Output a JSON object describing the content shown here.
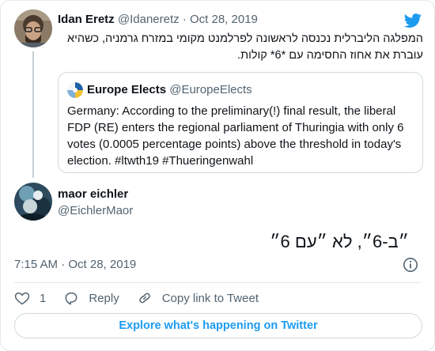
{
  "colors": {
    "accent": "#1d9bf0",
    "text": "#0f1419",
    "muted": "#536471",
    "border": "#cfd9de"
  },
  "parent": {
    "name": "Idan Eretz",
    "handle": "@Idaneretz",
    "separator": "·",
    "date": "Oct 28, 2019",
    "text": "המפלגה הליברלית נכנסה לראשונה לפרלמנט מקומי במזרח גרמניה, כשהיא עוברת את אחוז החסימה עם *6* קולות."
  },
  "quote": {
    "name": "Europe Elects",
    "handle": "@EuropeElects",
    "text": "Germany: According to the preliminary(!) final result, the liberal FDP (RE) enters the regional parliament of Thuringia with only 6 votes (0.0005 percentage points) above the threshold in today's election. #ltwth19 #Thueringenwahl"
  },
  "tweet": {
    "name": "maor eichler",
    "handle": "@EichlerMaor",
    "text": "״ב-6״, לא ״עם 6״",
    "timestamp": "7:15 AM · Oct 28, 2019"
  },
  "actions": {
    "like_count": "1",
    "reply_label": "Reply",
    "copy_label": "Copy link to Tweet"
  },
  "explore_label": "Explore what's happening on Twitter",
  "icons": [
    "twitter-logo-icon",
    "info-icon",
    "heart-icon",
    "reply-icon",
    "link-icon"
  ]
}
